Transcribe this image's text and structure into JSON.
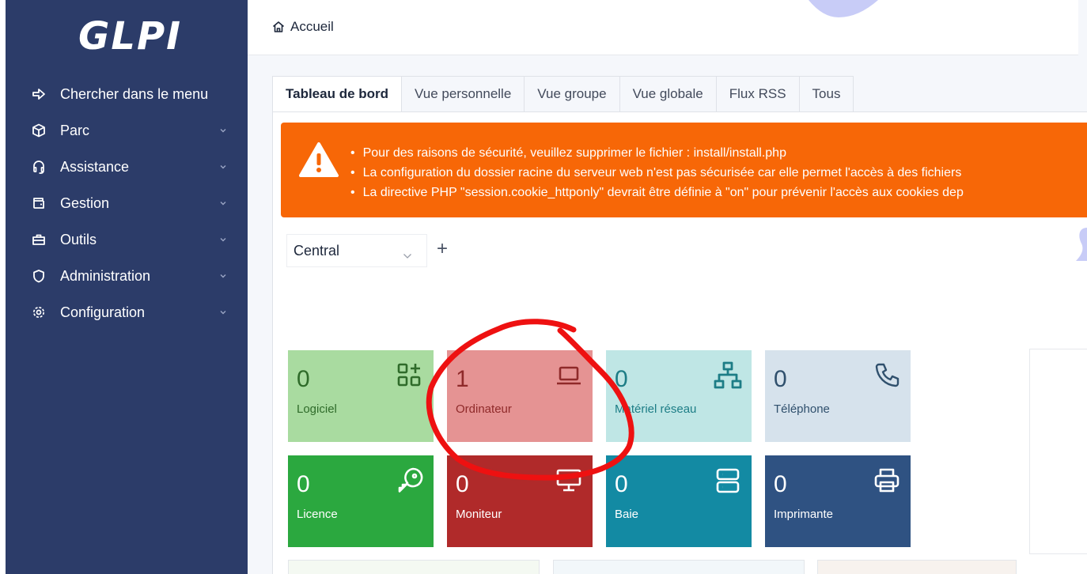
{
  "app": {
    "logo": "GLPI"
  },
  "sidebar": {
    "items": [
      {
        "label": "Chercher dans le menu",
        "icon": "arrow-right-to-bracket-icon",
        "chevron": false
      },
      {
        "label": "Parc",
        "icon": "box-icon",
        "chevron": true
      },
      {
        "label": "Assistance",
        "icon": "headset-icon",
        "chevron": true
      },
      {
        "label": "Gestion",
        "icon": "wallet-icon",
        "chevron": true
      },
      {
        "label": "Outils",
        "icon": "briefcase-icon",
        "chevron": true
      },
      {
        "label": "Administration",
        "icon": "shield-icon",
        "chevron": true
      },
      {
        "label": "Configuration",
        "icon": "gear-icon",
        "chevron": true
      }
    ]
  },
  "breadcrumb": {
    "home_label": "Accueil"
  },
  "tabs": [
    {
      "label": "Tableau de bord",
      "active": true
    },
    {
      "label": "Vue personnelle",
      "active": false
    },
    {
      "label": "Vue groupe",
      "active": false
    },
    {
      "label": "Vue globale",
      "active": false
    },
    {
      "label": "Flux RSS",
      "active": false
    },
    {
      "label": "Tous",
      "active": false
    }
  ],
  "alert": {
    "color": "#f76707",
    "messages": [
      "Pour des raisons de sécurité, veuillez supprimer le fichier : install/install.php",
      "La configuration du dossier racine du serveur web n'est pas sécurisée car elle permet l'accès à des fichiers",
      "La directive PHP \"session.cookie_httponly\" devrait être définie à \"on\" pour prévenir l'accès aux cookies dep"
    ]
  },
  "dashboard": {
    "selected": "Central",
    "add_label": "+"
  },
  "cards": [
    {
      "value": "0",
      "label": "Logiciel",
      "icon": "apps-add-icon",
      "bg": "#a9dba0",
      "fg": "#2f6b2a"
    },
    {
      "value": "1",
      "label": "Ordinateur",
      "icon": "laptop-icon",
      "bg": "#e59393",
      "fg": "#8f2a2a"
    },
    {
      "value": "0",
      "label": "Matériel réseau",
      "icon": "network-icon",
      "bg": "#bfe6e5",
      "fg": "#1d7d86"
    },
    {
      "value": "0",
      "label": "Téléphone",
      "icon": "phone-icon",
      "bg": "#d6e2ec",
      "fg": "#30506d"
    },
    {
      "value": "0",
      "label": "Licence",
      "icon": "key-icon",
      "bg": "#2ba83f",
      "fg": "#ffffff"
    },
    {
      "value": "0",
      "label": "Moniteur",
      "icon": "monitor-icon",
      "bg": "#b02a2a",
      "fg": "#ffffff"
    },
    {
      "value": "0",
      "label": "Baie",
      "icon": "server-icon",
      "bg": "#138aa3",
      "fg": "#ffffff"
    },
    {
      "value": "0",
      "label": "Imprimante",
      "icon": "printer-icon",
      "bg": "#2f5282",
      "fg": "#ffffff"
    }
  ],
  "colors": {
    "sidebar_bg": "#2c3c69",
    "annotation_red": "#ee1111",
    "decor_lavender": "#c8ccf7"
  }
}
